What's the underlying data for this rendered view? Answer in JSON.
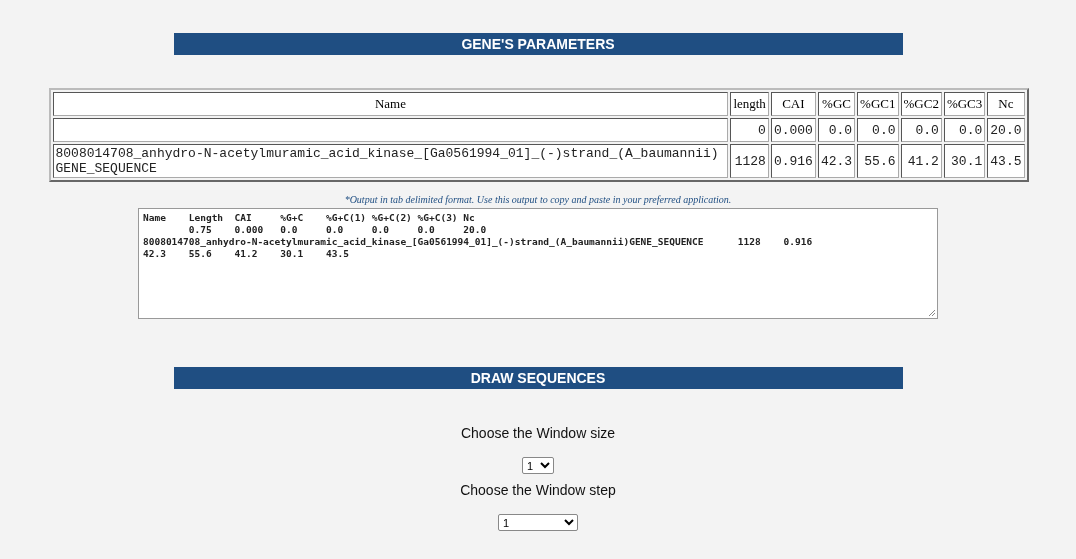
{
  "gene_parameters": {
    "title": "GENE'S PARAMETERS",
    "columns": [
      "Name",
      "length",
      "CAI",
      "%GC",
      "%GC1",
      "%GC2",
      "%GC3",
      "Nc"
    ],
    "rows": [
      {
        "cells": [
          "",
          "0",
          "0.000",
          "0.0",
          "0.0",
          "0.0",
          "0.0",
          "20.0"
        ]
      },
      {
        "cells": [
          "8008014708_anhydro-N-acetylmuramic_acid_kinase_[Ga0561994_01]_(-)strand_(A_baumannii)GENE_SEQUENCE",
          "1128",
          "0.916",
          "42.3",
          "55.6",
          "41.2",
          "30.1",
          "43.5"
        ]
      }
    ]
  },
  "output_note": "*Output in tab delimited format. Use this output to copy and paste in your preferred application.",
  "output_lines": [
    "Name\tLength\tCAI\t%G+C\t%G+C(1)\t%G+C(2)\t%G+C(3)\tNc",
    "\t0.75\t0.000\t0.0\t0.0\t0.0\t0.0\t20.0",
    "8008014708_anhydro-N-acetylmuramic_acid_kinase_[Ga0561994_01]_(-)strand_(A_baumannii)GENE_SEQUENCE\t1128\t0.916",
    "42.3\t55.6\t41.2\t30.1\t43.5"
  ],
  "draw_sequences": {
    "title": "DRAW SEQUENCES",
    "controls": [
      {
        "label": "Choose the Window size",
        "value": "1",
        "kind": "narrow"
      },
      {
        "label": "Choose the Window step",
        "value": "1",
        "kind": "wide"
      }
    ]
  }
}
